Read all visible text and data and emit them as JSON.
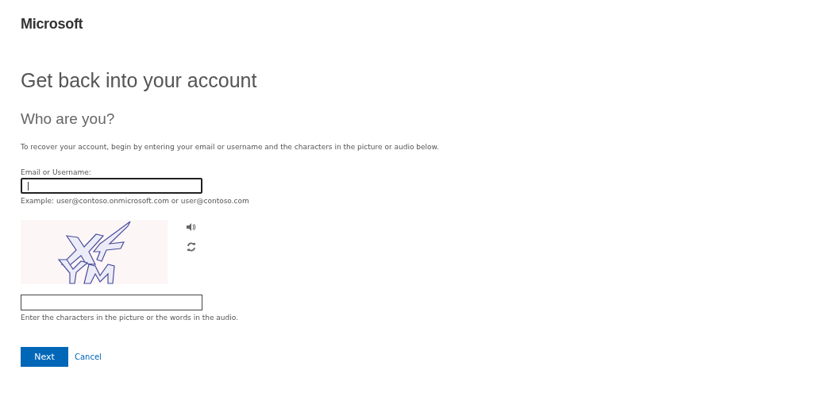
{
  "logo": "Microsoft",
  "title": "Get back into your account",
  "subtitle": "Who are you?",
  "intro": "To recover your account, begin by entering your email or username and the characters in the picture or audio below.",
  "email": {
    "label": "Email or Username:",
    "focused": true,
    "example": "Example: user@contoso.onmicrosoft.com or user@contoso.com"
  },
  "captcha": {
    "hint": "Enter the characters in the picture or the words in the audio."
  },
  "buttons": {
    "next": "Next",
    "cancel": "Cancel"
  }
}
